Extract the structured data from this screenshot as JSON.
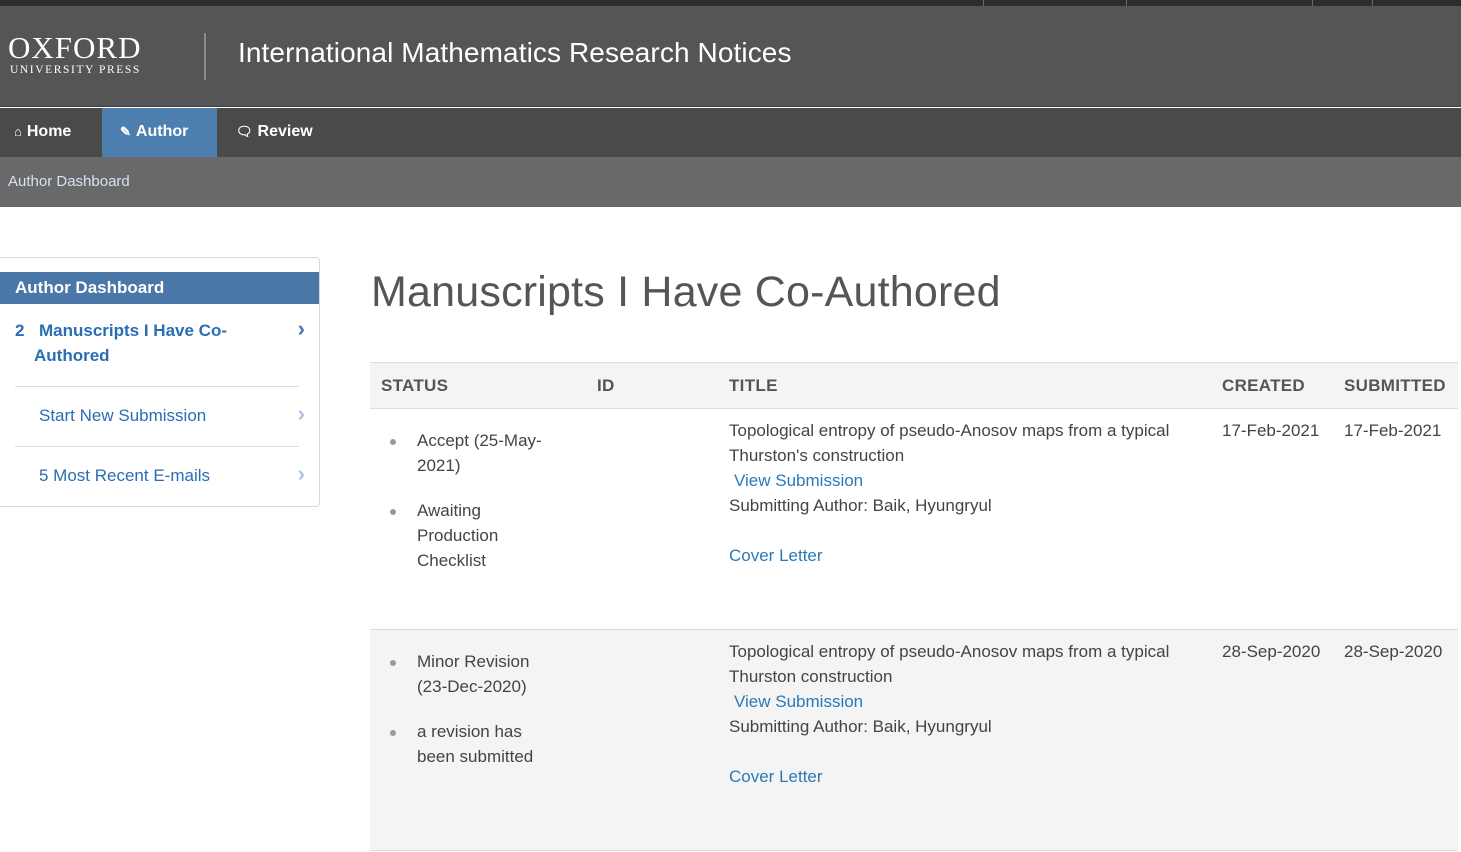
{
  "header": {
    "logo_main": "OXFORD",
    "logo_sub": "UNIVERSITY PRESS",
    "journal_title": "International Mathematics Research Notices"
  },
  "nav": {
    "items": [
      {
        "label": "Home",
        "icon": "home-icon"
      },
      {
        "label": "Author",
        "icon": "pencil-icon",
        "active": true
      },
      {
        "label": "Review",
        "icon": "speech-bubble-icon"
      }
    ]
  },
  "breadcrumb": {
    "label": "Author Dashboard"
  },
  "sidebar": {
    "heading": "Author Dashboard",
    "items": [
      {
        "count": "2",
        "label_line1": "Manuscripts I Have Co-",
        "label_line2": "Authored"
      },
      {
        "label": "Start New Submission"
      },
      {
        "label": "5 Most Recent E-mails"
      }
    ]
  },
  "main": {
    "title": "Manuscripts I Have Co-Authored",
    "columns": [
      "STATUS",
      "ID",
      "TITLE",
      "CREATED",
      "SUBMITTED"
    ],
    "rows": [
      {
        "status": [
          {
            "lines": [
              "Accept (25-May-",
              "2021)"
            ]
          },
          {
            "lines": [
              "Awaiting",
              "Production",
              "Checklist"
            ]
          }
        ],
        "id": "",
        "title_line1": "Topological entropy of pseudo-Anosov maps from a typical",
        "title_line2": "Thurston's construction",
        "view_link": "View Submission",
        "submitting_author": "Submitting Author: Baik, Hyungryul",
        "cover_letter": "Cover Letter",
        "created": "17-Feb-2021",
        "submitted": "17-Feb-2021"
      },
      {
        "status": [
          {
            "lines": [
              "Minor Revision",
              "(23-Dec-2020)"
            ]
          },
          {
            "lines": [
              "a revision has",
              "been submitted"
            ]
          }
        ],
        "id": "",
        "title_line1": "Topological entropy of pseudo-Anosov maps from a typical",
        "title_line2": "Thurston construction",
        "view_link": "View Submission",
        "submitting_author": "Submitting Author: Baik, Hyungryul",
        "cover_letter": "Cover Letter",
        "created": "28-Sep-2020",
        "submitted": "28-Sep-2020"
      }
    ]
  },
  "colors": {
    "header_bg": "#555555",
    "nav_bg": "#4a4a4a",
    "nav_active": "#4c7fae",
    "sidebar_head": "#4a77a8",
    "link": "#2a7ab8"
  }
}
